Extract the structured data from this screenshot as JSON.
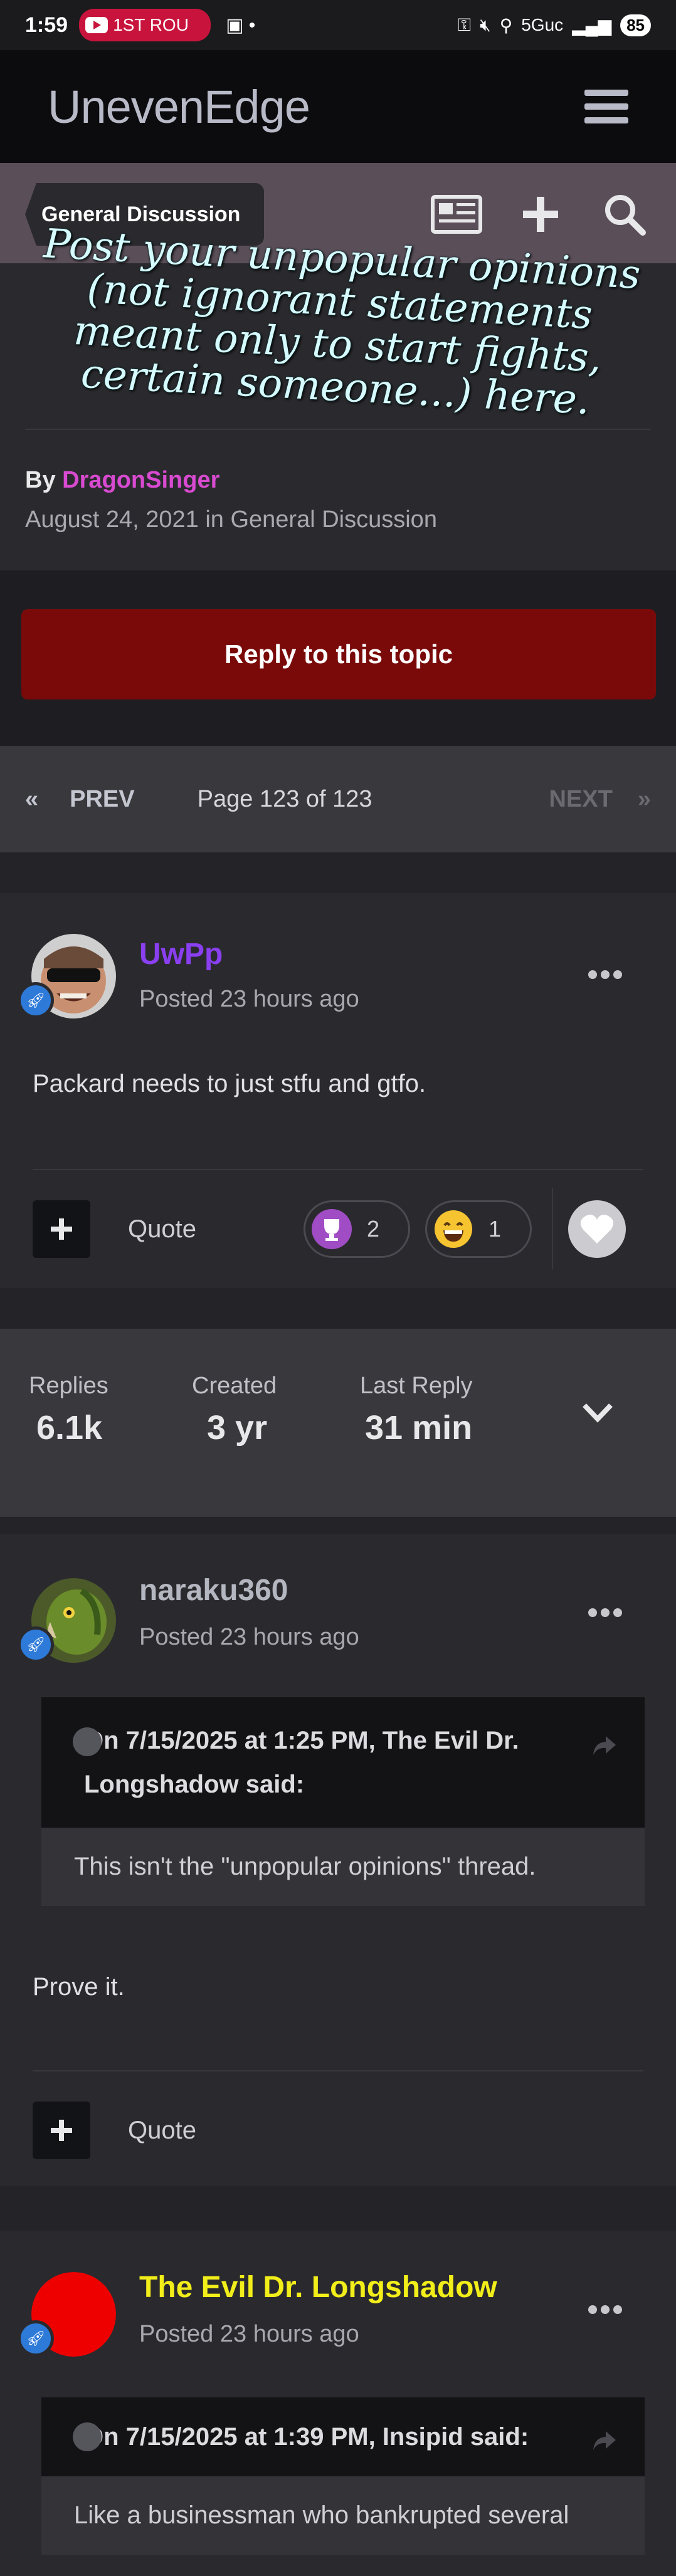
{
  "status_bar": {
    "time": "1:59",
    "notification": "1ST ROU",
    "network": "5Guc",
    "battery": "85"
  },
  "header": {
    "title": "UnevenEdge"
  },
  "topic_bar": {
    "breadcrumb": "General Discussion"
  },
  "topic": {
    "title": "Post your unpopular opinions (not ignorant statements meant only to start fights, certain someone...) here.",
    "by_label": "By",
    "author": "DragonSinger",
    "date_line": "August 24, 2021 in General Discussion"
  },
  "reply_button": "Reply to this topic",
  "pagination": {
    "prev": "PREV",
    "page_info": "Page 123 of 123",
    "next": "NEXT"
  },
  "posts": [
    {
      "author": "UwPp",
      "author_color": "#8a3ff0",
      "posted": "Posted 23 hours ago",
      "body": "Packard needs to just stfu and gtfo.",
      "quote_label": "Quote",
      "reactions": [
        {
          "icon": "trophy-icon",
          "count": "2"
        },
        {
          "icon": "laugh-emoji-icon",
          "count": "1"
        }
      ]
    },
    {
      "author": "naraku360",
      "author_color": "#b4b6c0",
      "posted": "Posted 23 hours ago",
      "quote_header": "On 7/15/2025 at 1:25 PM, The Evil Dr. Longshadow said:",
      "quote_text": "This isn't the \"unpopular opinions\" thread.",
      "body": "Prove it.",
      "quote_label": "Quote"
    },
    {
      "author": "The Evil Dr. Longshadow",
      "author_color": "#f2ee1a",
      "posted": "Posted 23 hours ago",
      "quote_header": "On 7/15/2025 at 1:39 PM, Insipid said:",
      "quote_text": "Like a businessman who bankrupted several"
    }
  ],
  "stats": {
    "replies_label": "Replies",
    "replies": "6.1k",
    "created_label": "Created",
    "created": "3 yr",
    "last_reply_label": "Last Reply",
    "last_reply": "31 min"
  }
}
